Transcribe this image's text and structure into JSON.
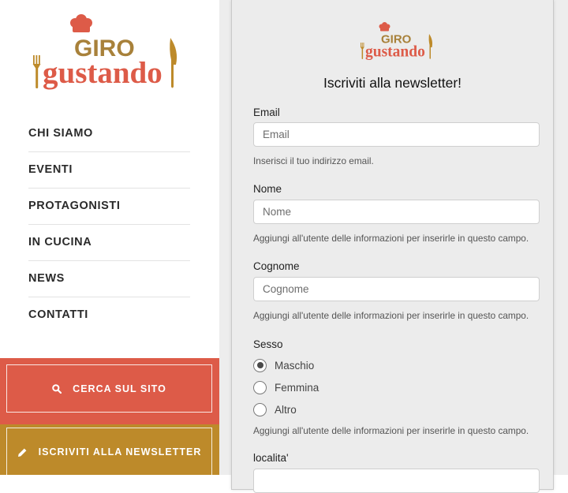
{
  "logo": {
    "line1": "GIRO",
    "line2": "gustando"
  },
  "colors": {
    "brand_red": "#dd5b48",
    "brand_gold": "#bd8a2a",
    "logo_tan": "#a8813a"
  },
  "nav": {
    "items": [
      {
        "label": "CHI SIAMO"
      },
      {
        "label": "EVENTI"
      },
      {
        "label": "PROTAGONISTI"
      },
      {
        "label": "IN CUCINA"
      },
      {
        "label": "NEWS"
      },
      {
        "label": "CONTATTI"
      }
    ]
  },
  "sidebar_actions": {
    "search_label": "CERCA SUL SITO",
    "search_icon": "search-icon",
    "newsletter_label": "ISCRIVITI ALLA NEWSLETTER",
    "newsletter_icon": "pencil-icon"
  },
  "form": {
    "title": "Iscriviti alla newsletter!",
    "email": {
      "label": "Email",
      "placeholder": "Email",
      "value": "",
      "help": "Inserisci il tuo indirizzo email."
    },
    "nome": {
      "label": "Nome",
      "placeholder": "Nome",
      "value": "",
      "help": "Aggiungi all'utente delle informazioni per inserirle in questo campo."
    },
    "cognome": {
      "label": "Cognome",
      "placeholder": "Cognome",
      "value": "",
      "help": "Aggiungi all'utente delle informazioni per inserirle in questo campo."
    },
    "sesso": {
      "label": "Sesso",
      "options": [
        "Maschio",
        "Femmina",
        "Altro"
      ],
      "selected": "Maschio",
      "help": "Aggiungi all'utente delle informazioni per inserirle in questo campo."
    },
    "localita": {
      "label": "localita'"
    }
  }
}
